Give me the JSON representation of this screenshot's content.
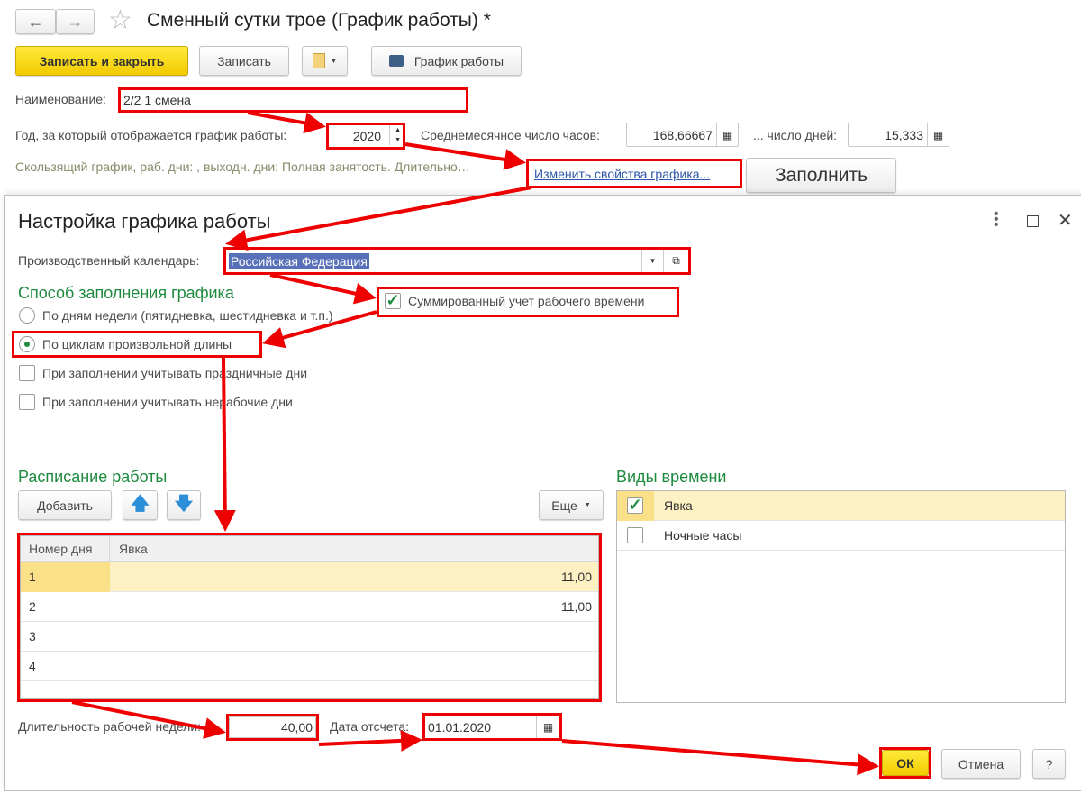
{
  "header": {
    "title": "Сменный сутки трое (График работы) *",
    "back_icon": "arrow-left-icon",
    "forward_icon": "arrow-right-icon",
    "favorite_icon": "star-icon"
  },
  "toolbar": {
    "save_close": "Записать и закрыть",
    "save": "Записать",
    "print_schedule": "График работы"
  },
  "form": {
    "name_label": "Наименование:",
    "name_value": "2/2 1 смена",
    "year_label": "Год, за который отображается график работы:",
    "year_value": "2020",
    "avg_hours_label": "Среднемесячное число часов:",
    "avg_hours_value": "168,66667",
    "days_label": "... число дней:",
    "days_value": "15,333",
    "description": "Скользящий график, раб. дни: , выходн. дни:  Полная занятость. Длительно…",
    "change_link": "Изменить свойства графика...",
    "fill_button": "Заполнить"
  },
  "dialog": {
    "title": "Настройка графика работы",
    "calendar_label": "Производственный календарь:",
    "calendar_value": "Российская Федерация",
    "method_heading": "Способ заполнения графика",
    "summary_accounting": "Суммированный учет рабочего времени",
    "summary_accounting_checked": true,
    "radio_weekdays": "По дням недели (пятидневка, шестидневка и т.п.)",
    "radio_cycles": "По циклам произвольной длины",
    "selected_method": "cycles",
    "holidays": "При заполнении учитывать праздничные дни",
    "holidays_checked": false,
    "nonworking": "При заполнении учитывать нерабочие дни",
    "nonworking_checked": false,
    "schedule_heading": "Расписание работы",
    "add_button": "Добавить",
    "more_button": "Еще",
    "columns": [
      "Номер дня",
      "Явка"
    ],
    "rows": [
      {
        "day": "1",
        "hours": "11,00"
      },
      {
        "day": "2",
        "hours": "11,00"
      },
      {
        "day": "3",
        "hours": ""
      },
      {
        "day": "4",
        "hours": ""
      }
    ],
    "time_types_heading": "Виды времени",
    "time_types": [
      {
        "label": "Явка",
        "checked": true
      },
      {
        "label": "Ночные часы",
        "checked": false
      }
    ],
    "week_length_label": "Длительность рабочей недели:",
    "week_length_value": "40,00",
    "start_date_label": "Дата отсчета:",
    "start_date_value": "01.01.2020",
    "ok": "ОК",
    "cancel": "Отмена",
    "help": "?"
  },
  "colors": {
    "accent_yellow": "#f5d000",
    "heading_green": "#1e8a3e",
    "annotation_red": "#ee0000",
    "selection_row": "#fdf1c4"
  }
}
